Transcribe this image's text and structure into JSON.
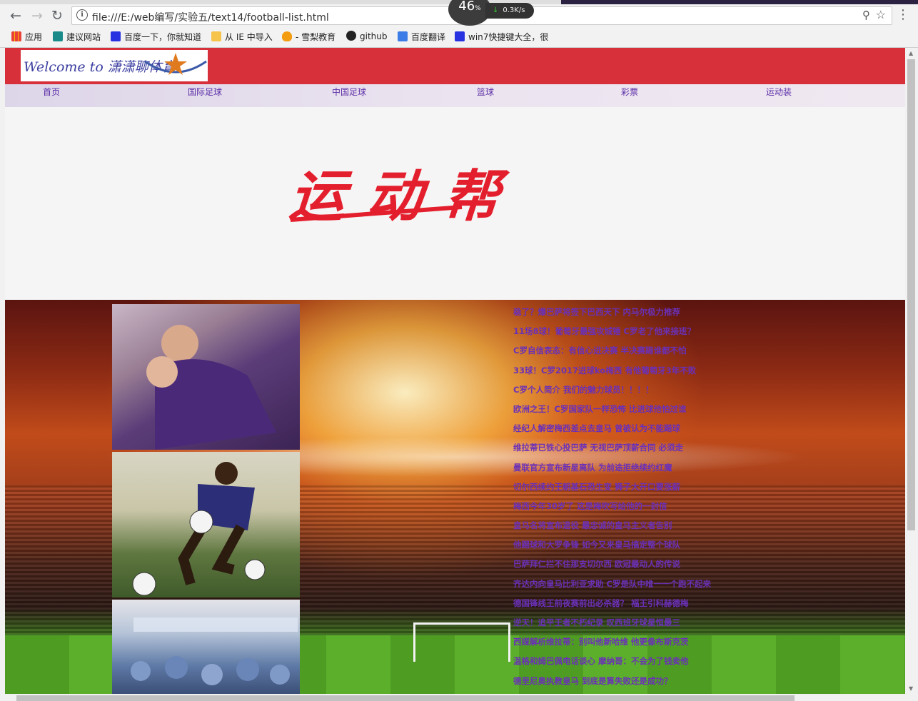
{
  "browser": {
    "url": "file:///E:/web编写/实验五/text14/football-list.html",
    "speed_percent": "46",
    "speed_unit": "%",
    "net_speed": "0.3K/s",
    "bookmarks": [
      {
        "label": "应用",
        "icon": "apps-grid-icon",
        "color": "#4285f4"
      },
      {
        "label": "建议网站",
        "icon": "bing-icon",
        "color": "#1a8b8a"
      },
      {
        "label": "百度一下，你就知道",
        "icon": "baidu-paw-icon",
        "color": "#2932e1"
      },
      {
        "label": "从 IE 中导入",
        "icon": "folder-icon",
        "color": "#f6c34b"
      },
      {
        "label": "- 雪梨教育",
        "icon": "flame-icon",
        "color": "#f39c12"
      },
      {
        "label": "github",
        "icon": "github-icon",
        "color": "#222222"
      },
      {
        "label": "百度翻译",
        "icon": "translate-icon",
        "color": "#3b7ce6"
      },
      {
        "label": "win7快捷键大全，很",
        "icon": "baidu-paw-icon",
        "color": "#2932e1"
      }
    ]
  },
  "header": {
    "logo_text": "Welcome to 潇潇聊体育",
    "brand_color": "#d7303b"
  },
  "nav": {
    "items": [
      "首页",
      "国际足球",
      "中国足球",
      "篮球",
      "彩票",
      "运动装"
    ]
  },
  "banner": {
    "title": "运动帮",
    "color": "#e41f2d"
  },
  "news": [
    "稳了？爆巴萨将签下巴西天下 内马尔极力推荐",
    "11场8球！葡萄牙最强攻城锤 C罗老了他来接班？",
    "C罗自信表态：有信心进决赛 半决赛踢谁都不怕",
    "33球！C罗2017进球ko梅西 有他葡萄牙3年不败",
    "C罗个人简介 我们的魅力球员！！！！",
    "欧洲之王！C罗国家队一样恐怖 比进球他怕过谁",
    "经纪人解密梅西差点去皇马 曾被认为不能踢球",
    "维拉蒂已铁心投巴萨 无视巴萨顶薪合同 必须走",
    "曼联官方宣布新星离队 为前途拒绝续约红魔",
    "切尔西续约王朝基石恐生变 狮子大开口要涨薪",
    "梅西今年30岁了 这是梅吹写给他的一封信",
    "皇马名将宣布退役 最忠诚的皇马主义者告别",
    "他踢球和大罗争锋 如今又来皇马搞定整个球队",
    "巴萨拜仁拦不住那支切尔西 欧冠最动人的传说",
    "齐达内向皇马比利亚求助 C罗是队中唯一一个跑不起来",
    "德国锋线王前夜赛前出必杀器？ 福王引科赫德梅",
    "逆天！追平王者不朽纪录 叹西班牙球星恒最三",
    "西媒解析维拉蒂：别叫他新哈维 他更像布斯克茨",
    "温格和姆巴佩电话谈心 摩纳哥：不会为了钱卖他",
    "德里尼奥执教皇马 到底是算失败还是成功？"
  ]
}
